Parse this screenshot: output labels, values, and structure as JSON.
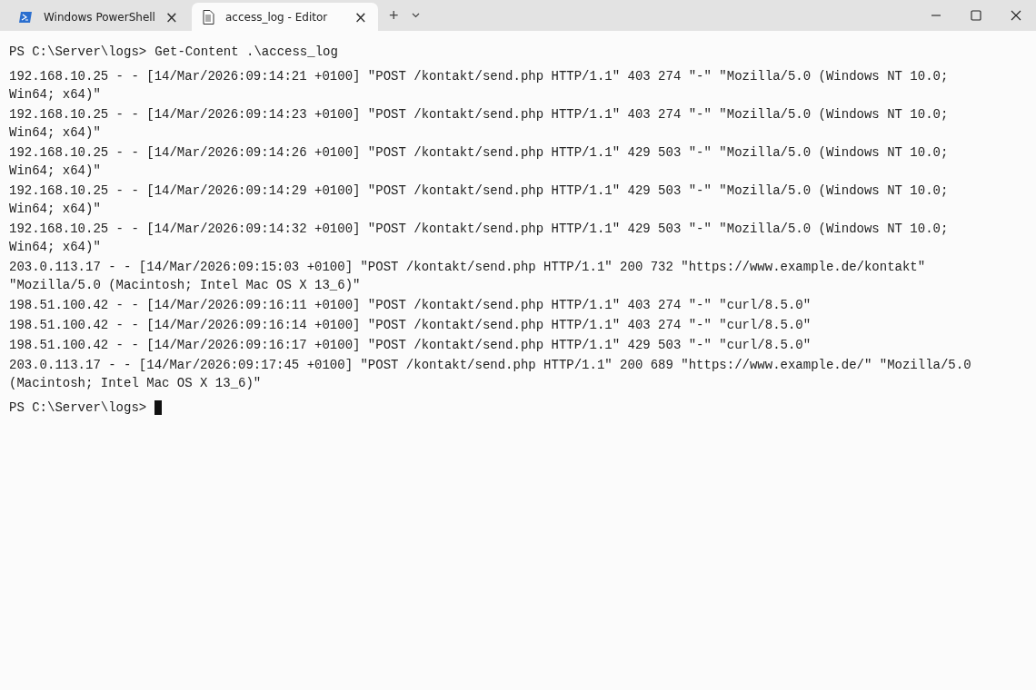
{
  "tabs": [
    {
      "kind": "powershell",
      "title": "Windows PowerShell",
      "selected": false,
      "close": "×"
    },
    {
      "kind": "document",
      "title": "access_log - Editor",
      "selected": true,
      "close": "×"
    }
  ],
  "new_tab": "+",
  "prompt_command": {
    "prompt": "PS C:\\Server\\logs>",
    "command": "Get-Content .\\access_log"
  },
  "log_lines": [
    "192.168.10.25 - - [14/Mar/2026:09:14:21 +0100] \"POST /kontakt/send.php HTTP/1.1\" 403 274 \"-\" \"Mozilla/5.0 (Windows NT 10.0; Win64; x64)\"",
    "192.168.10.25 - - [14/Mar/2026:09:14:23 +0100] \"POST /kontakt/send.php HTTP/1.1\" 403 274 \"-\" \"Mozilla/5.0 (Windows NT 10.0; Win64; x64)\"",
    "192.168.10.25 - - [14/Mar/2026:09:14:26 +0100] \"POST /kontakt/send.php HTTP/1.1\" 429 503 \"-\" \"Mozilla/5.0 (Windows NT 10.0; Win64; x64)\"",
    "192.168.10.25 - - [14/Mar/2026:09:14:29 +0100] \"POST /kontakt/send.php HTTP/1.1\" 429 503 \"-\" \"Mozilla/5.0 (Windows NT 10.0; Win64; x64)\"",
    "192.168.10.25 - - [14/Mar/2026:09:14:32 +0100] \"POST /kontakt/send.php HTTP/1.1\" 429 503 \"-\" \"Mozilla/5.0 (Windows NT 10.0; Win64; x64)\"",
    "203.0.113.17 - - [14/Mar/2026:09:15:03 +0100] \"POST /kontakt/send.php HTTP/1.1\" 200 732 \"https://www.example.de/kontakt\" \"Mozilla/5.0 (Macintosh; Intel Mac OS X 13_6)\"",
    "198.51.100.42 - - [14/Mar/2026:09:16:11 +0100] \"POST /kontakt/send.php HTTP/1.1\" 403 274 \"-\" \"curl/8.5.0\"",
    "198.51.100.42 - - [14/Mar/2026:09:16:14 +0100] \"POST /kontakt/send.php HTTP/1.1\" 403 274 \"-\" \"curl/8.5.0\"",
    "198.51.100.42 - - [14/Mar/2026:09:16:17 +0100] \"POST /kontakt/send.php HTTP/1.1\" 429 503 \"-\" \"curl/8.5.0\"",
    "203.0.113.17 - - [14/Mar/2026:09:17:45 +0100] \"POST /kontakt/send.php HTTP/1.1\" 200 689 \"https://www.example.de/\" \"Mozilla/5.0 (Macintosh; Intel Mac OS X 13_6)\""
  ],
  "prompt": "PS C:\\Server\\logs>"
}
